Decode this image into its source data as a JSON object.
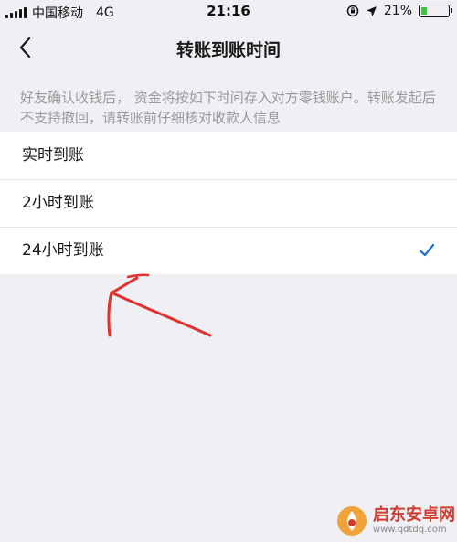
{
  "status_bar": {
    "carrier": "中国移动",
    "network": "4G",
    "time": "21:16",
    "battery_percent": "21%",
    "battery_level": 0.21,
    "battery_color": "#3ec13e"
  },
  "nav": {
    "back_icon": "chevron-left-icon",
    "title": "转账到账时间"
  },
  "notice": "好友确认收钱后， 资金将按如下时间存入对方零钱账户。转账发起后不支持撤回，请转账前仔细核对收款人信息",
  "options": [
    {
      "label": "实时到账",
      "selected": false
    },
    {
      "label": "2小时到账",
      "selected": false
    },
    {
      "label": "24小时到账",
      "selected": true
    }
  ],
  "accent_color": "#1a73d9",
  "annotation_color": "#e0312f",
  "watermark": {
    "text": "启东安卓网",
    "url": "www.qdtdq.com"
  }
}
